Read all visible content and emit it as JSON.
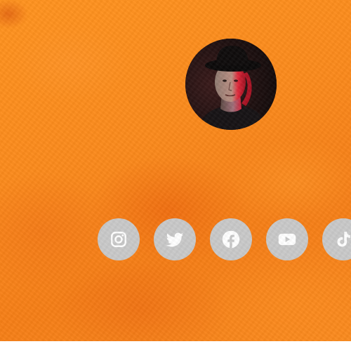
{
  "page": {
    "background_color": "#f98519"
  },
  "profile": {
    "avatar_description": "avatar",
    "avatar_border_color": "#140d0d"
  },
  "social": {
    "button_color": "#c9c9c9",
    "icon_color": "#ffffff",
    "links": [
      {
        "icon": "instagram-icon"
      },
      {
        "icon": "twitter-icon"
      },
      {
        "icon": "facebook-icon"
      },
      {
        "icon": "youtube-icon"
      },
      {
        "icon": "tiktok-icon"
      }
    ]
  }
}
